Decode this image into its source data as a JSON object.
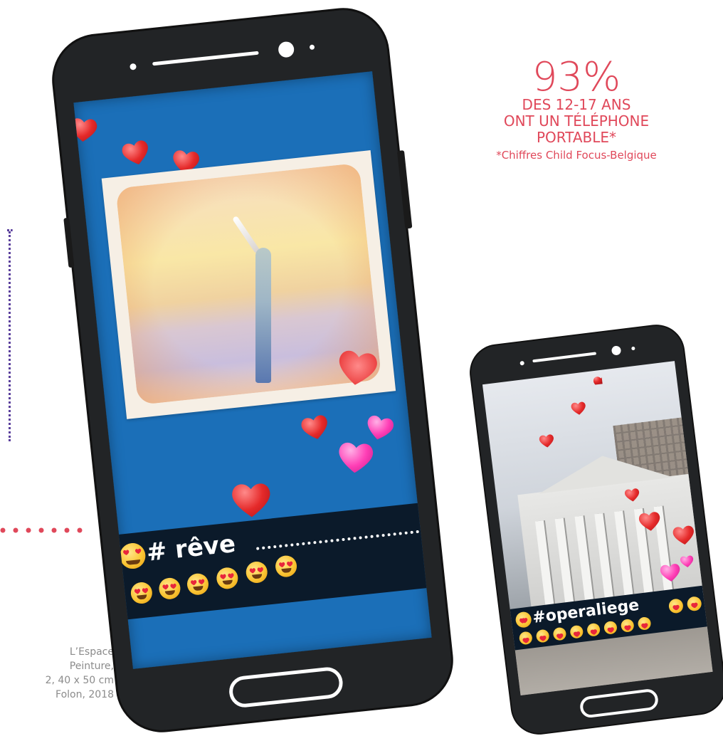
{
  "stat": {
    "percent": "93%",
    "line1": "DES 12-17 ANS",
    "line2": "ONT UN TÉLÉPHONE",
    "line3": "PORTABLE*",
    "source": "*Chiffres Child Focus-Belgique"
  },
  "credits": {
    "line1": "L’Espace",
    "line2": "Peinture,",
    "line3": "2, 40 x 50 cm",
    "line4": "Folon, 2018"
  },
  "phone_big": {
    "hashtag": "# rêve"
  },
  "phone_small": {
    "hashtag": "#operaliege"
  },
  "colors": {
    "accent": "#e0485a",
    "screen_blue": "#1b6fb8",
    "banner": "#0b1a2a",
    "phone_body": "#222426",
    "dots_purple": "#5a3f9c",
    "credit_gray": "#8b8b8b"
  }
}
